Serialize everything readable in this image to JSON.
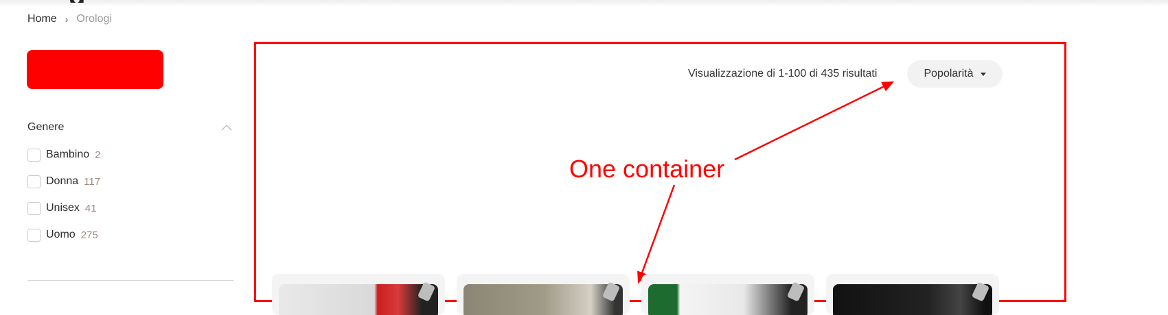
{
  "breadcrumb": {
    "home": "Home",
    "separator": "›",
    "current": "Orologi"
  },
  "page_title_fragment": "g",
  "sidebar": {
    "primary_button_label": "",
    "primary_button_color": "#ff0000",
    "filter": {
      "title": "Genere",
      "collapse_icon": "chevron-up-icon",
      "items": [
        {
          "label": "Bambino",
          "count": "2"
        },
        {
          "label": "Donna",
          "count": "117"
        },
        {
          "label": "Unisex",
          "count": "41"
        },
        {
          "label": "Uomo",
          "count": "275"
        }
      ]
    }
  },
  "results": {
    "summary": "Visualizzazione di 1-100 di 435 risultati",
    "sort_selected": "Popolarità",
    "sort_icon": "caret-down-icon"
  },
  "annotation": {
    "label": "One container",
    "color": "#ff0000"
  },
  "products": [
    {
      "image": "watch-thumbnail"
    },
    {
      "image": "watch-thumbnail"
    },
    {
      "image": "watch-thumbnail"
    },
    {
      "image": "watch-thumbnail"
    }
  ]
}
